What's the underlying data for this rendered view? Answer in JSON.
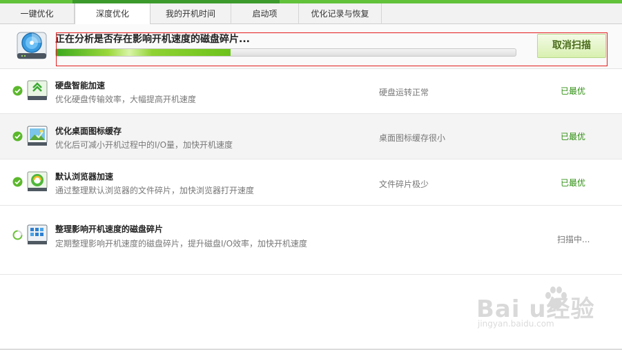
{
  "tabs": [
    {
      "label": "一键优化",
      "active": false
    },
    {
      "label": "深度优化",
      "active": true
    },
    {
      "label": "我的开机时间",
      "active": false
    },
    {
      "label": "启动项",
      "active": false
    },
    {
      "label": "优化记录与恢复",
      "active": false
    }
  ],
  "scan": {
    "title": "正在分析是否存在影响开机速度的磁盘碎片...",
    "progress_percent": 38,
    "cancel_label": "取消扫描",
    "icon": "disk-scan-icon"
  },
  "items": [
    {
      "title": "硬盘智能加速",
      "desc": "优化硬盘传输效率，大幅提高开机速度",
      "state": "硬盘运转正常",
      "result": "已最优",
      "status": "done",
      "icon": "disk-accelerate-icon"
    },
    {
      "title": "优化桌面图标缓存",
      "desc": "优化后可减小开机过程中的I/O量，加快开机速度",
      "state": "桌面图标缓存很小",
      "result": "已最优",
      "status": "done",
      "icon": "desktop-picture-icon"
    },
    {
      "title": "默认浏览器加速",
      "desc": "通过整理默认浏览器的文件碎片，加快浏览器打开速度",
      "state": "文件碎片极少",
      "result": "已最优",
      "status": "done",
      "icon": "browser-icon"
    },
    {
      "title": "整理影响开机速度的磁盘碎片",
      "desc": "定期整理影响开机速度的磁盘碎片，提升磁盘I/O效率，加快开机速度",
      "state": "",
      "result": "扫描中...",
      "status": "scanning",
      "icon": "defrag-grid-icon"
    }
  ],
  "watermark": {
    "brand": "Bai  u经验",
    "url": "jingyan.baidu.com"
  },
  "colors": {
    "accent_green": "#3c9a2c",
    "result_green": "#2f8f12",
    "highlight_red": "#e31c1c"
  }
}
